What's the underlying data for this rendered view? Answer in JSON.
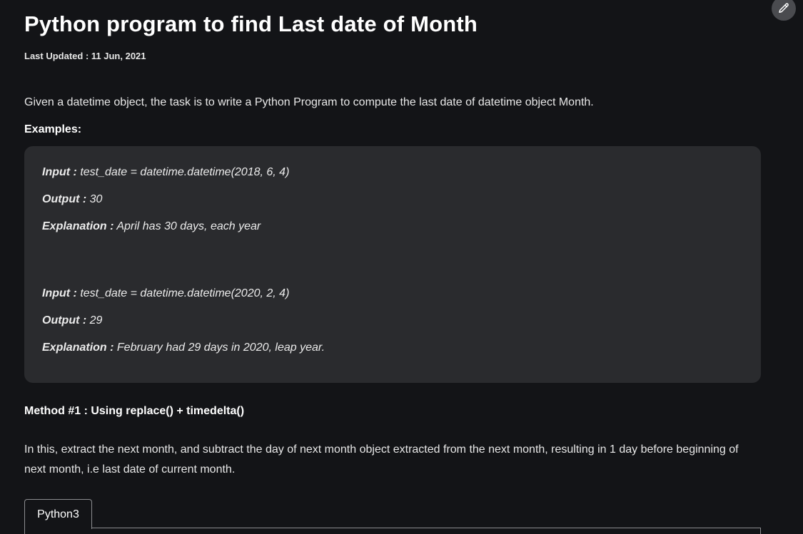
{
  "article": {
    "title": "Python program to find Last date of Month",
    "last_updated": "Last Updated : 11 Jun, 2021",
    "intro": "Given a datetime object, the task is to write a Python Program to compute the last date of datetime object Month.",
    "examples_heading": "Examples:",
    "examples": [
      {
        "input_label": "Input :",
        "input_value": "test_date = datetime.datetime(2018, 6, 4)",
        "output_label": "Output :",
        "output_value": "30",
        "explanation_label": "Explanation :",
        "explanation_value": "April has 30 days, each year"
      },
      {
        "input_label": "Input :",
        "input_value": "test_date = datetime.datetime(2020, 2, 4)",
        "output_label": "Output :",
        "output_value": "29",
        "explanation_label": "Explanation :",
        "explanation_value": "February had 29 days in 2020, leap year."
      }
    ],
    "method_heading": "Method #1 : Using replace() + timedelta()",
    "method_text": "In this, extract the next month, and subtract the day of next month object extracted from the next month, resulting in 1 day before beginning of next month, i.e last date of current month."
  },
  "code_tabs": {
    "active": "Python3"
  },
  "icons": {
    "edit": "pencil-icon"
  }
}
